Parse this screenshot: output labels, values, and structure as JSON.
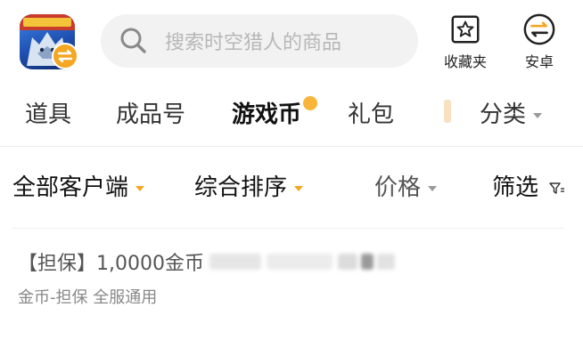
{
  "header": {
    "search_placeholder": "搜索时空猎人的商品",
    "favorites_label": "收藏夹",
    "platform_label": "安卓"
  },
  "category_tabs": [
    "道具",
    "成品号",
    "游戏币",
    "礼包"
  ],
  "active_tab": "游戏币",
  "category_more_label": "分类",
  "filters": {
    "client_label": "全部客户端",
    "sort_label": "综合排序",
    "price_label": "价格",
    "filter_label": "筛选"
  },
  "listing": {
    "title": "【担保】1,0000金币",
    "subtitle": "金币-担保 全服通用"
  },
  "colors": {
    "accent": "#f5a623",
    "search_bg": "#f2f2f2",
    "hot_dot": "#f8b53a"
  }
}
